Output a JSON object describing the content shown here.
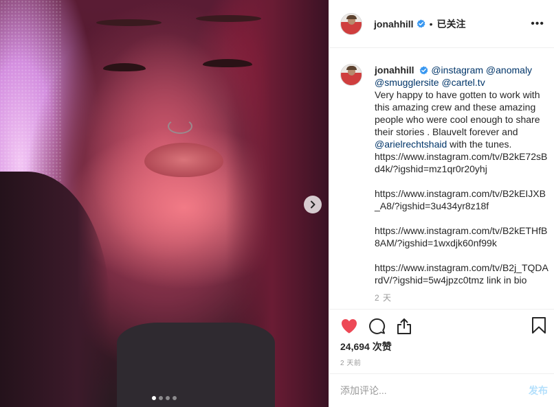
{
  "post": {
    "username": "jonahhill",
    "follow_separator": "•",
    "follow_state": "已关注",
    "more_label": "•••",
    "caption": {
      "username": "jonahhill",
      "mentions_line1": [
        "@instagram",
        "@anomaly"
      ],
      "mentions_line2": [
        "@smugglersite",
        "@cartel.tv"
      ],
      "text": "Very happy to have gotten to work with this amazing crew and these amazing people who were cool enough to share their stories . Blauvelt forever and",
      "mention_inline": "@arielrechtshaid",
      "text_after_mention": "with the tunes.",
      "urls": [
        "https://www.instagram.com/tv/B2kE72sBd4k/?igshid=mz1qr0r20yhj",
        "https://www.instagram.com/tv/B2kEIJXB_A8/?igshid=3u434yr8z18f",
        "https://www.instagram.com/tv/B2kETHfB8AM/?igshid=1wxdjk60nf99k",
        "https://www.instagram.com/tv/B2j_TQDArdV/?igshid=5w4jpzc0tmz link in bio"
      ],
      "age": "2 天"
    },
    "likes": "24,694 次赞",
    "posted_ago": "2 天前",
    "carousel": {
      "count": 4,
      "active": 0
    }
  },
  "comment_box": {
    "placeholder": "添加评论...",
    "post_label": "发布"
  },
  "colors": {
    "link": "#003569",
    "verified": "#3897f0",
    "liked": "#ed4956",
    "post_disabled": "#b2dffc"
  },
  "icons": [
    "verified-badge-icon",
    "chevron-right-icon",
    "heart-icon",
    "comment-icon",
    "share-icon",
    "bookmark-icon",
    "more-options-icon"
  ]
}
